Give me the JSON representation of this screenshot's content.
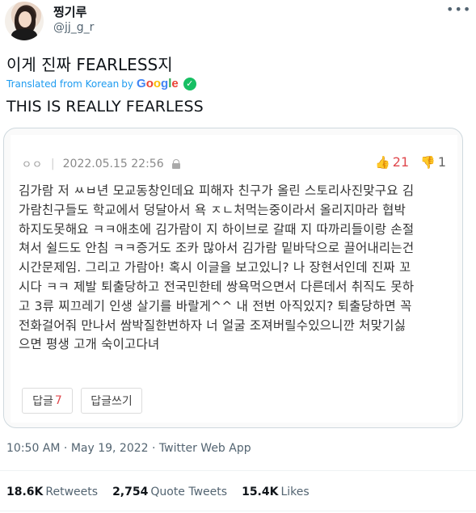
{
  "author": {
    "display_name": "찡기루",
    "handle": "@jj_g_r"
  },
  "more_icon": "more-dots-icon",
  "tweet": {
    "text": "이게 진짜 FEARLESS지",
    "translated_from": "Translated from Korean",
    "by": "by",
    "translation_provider": [
      "G",
      "o",
      "o",
      "g",
      "l",
      "e"
    ],
    "translated_text": "THIS IS REALLY FEARLESS",
    "verified_icon": "check-icon"
  },
  "media_post": {
    "nickname": "ㅇㅇ",
    "date": "2022.05.15 22:56",
    "likes": "21",
    "dislikes": "1",
    "body_lines": [
      "김가람 저 ㅆㅂ년 모교동창인데요 피해자 친구가 올린 스토리사진맞구요 김",
      "가람친구들도 학교에서 덩달아서 욕 ㅈㄴ처먹는중이라서 올리지마라 협박",
      "하지도못해요 ㅋㅋ애초에 김가람이 지 하이브로 갈때 지 따까리들이랑 손절",
      "쳐서 쉴드도 안침 ㅋㅋ증거도 조카 많아서 김가람 밑바닥으로 끌어내리는건",
      "시간문제임. 그리고 가람아! 혹시 이글을 보고있니? 나 장현서인데 진짜 꼬",
      "시다 ㅋㅋ 제발 퇴출당하고 전국민한테 쌍욕먹으면서 다른데서 취직도 못하",
      "고 3류 찌끄레기 인생 살기를 바랄게^^ 내 전번 아직있지? 퇴출당하면 꼭",
      "전화걸어줘 만나서 쌈박질한번하자 너 얼굴 조져버릴수있으니깐 처맞기싫",
      "으면 평생 고개 숙이고다녀"
    ],
    "reply_label": "답글",
    "reply_count": "7",
    "write_reply_label": "답글쓰기"
  },
  "meta": {
    "time": "10:50 AM",
    "separator": "·",
    "date": "May 19, 2022",
    "source": "Twitter Web App"
  },
  "stats": {
    "retweets": {
      "count": "18.6K",
      "label": "Retweets"
    },
    "quotes": {
      "count": "2,754",
      "label": "Quote Tweets"
    },
    "likes": {
      "count": "15.4K",
      "label": "Likes"
    }
  },
  "colors": {
    "link_blue": "#1d9bf0",
    "secondary_text": "#536471",
    "vote_red": "#e0494e"
  }
}
